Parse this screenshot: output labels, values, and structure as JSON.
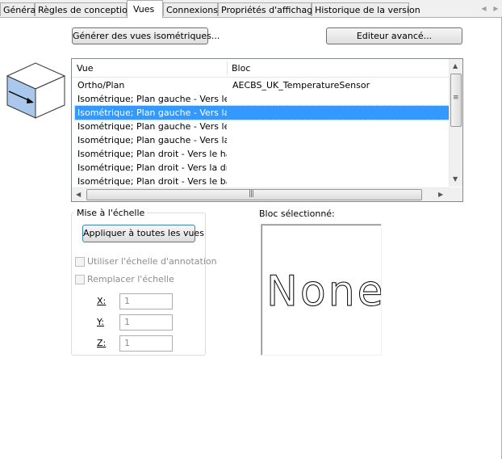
{
  "tabs": [
    {
      "label": "Général",
      "active": false
    },
    {
      "label": "Règles de conception",
      "active": false
    },
    {
      "label": "Vues",
      "active": true
    },
    {
      "label": "Connexions",
      "active": false
    },
    {
      "label": "Propriétés d'affichage",
      "active": false
    },
    {
      "label": "Historique de la version",
      "active": false
    }
  ],
  "buttons": {
    "generate_iso": "Générer des vues isométriques...",
    "advanced_editor": "Editeur avancé...",
    "apply_all": "Appliquer à toutes les vues"
  },
  "views_list": {
    "columns": [
      "Vue",
      "Bloc"
    ],
    "selected_index": 2,
    "rows": [
      {
        "vue": "Ortho/Plan",
        "bloc": "AECBS_UK_TemperatureSensor"
      },
      {
        "vue": "Isométrique; Plan gauche - Vers le ...",
        "bloc": ""
      },
      {
        "vue": "Isométrique; Plan gauche - Vers la ...",
        "bloc": ""
      },
      {
        "vue": "Isométrique; Plan gauche - Vers le bas",
        "bloc": ""
      },
      {
        "vue": "Isométrique; Plan gauche - Vers la ...",
        "bloc": ""
      },
      {
        "vue": "Isométrique; Plan droit - Vers le haut",
        "bloc": ""
      },
      {
        "vue": "Isométrique; Plan droit - Vers la droite",
        "bloc": ""
      },
      {
        "vue": "Isométrique; Plan droit - Vers le bas",
        "bloc": ""
      }
    ]
  },
  "scale": {
    "group_title": "Mise à l'échelle",
    "use_annotation_scale": {
      "label": "Utiliser l'échelle d'annotation",
      "checked": false
    },
    "override_scale": {
      "label": "Remplacer l'échelle",
      "checked": false
    },
    "x": {
      "label": "X:",
      "value": "1"
    },
    "y": {
      "label": "Y:",
      "value": "1"
    },
    "z": {
      "label": "Z:",
      "value": "1"
    }
  },
  "selected_block": {
    "label": "Bloc sélectionné:",
    "preview_text": "None"
  },
  "colors": {
    "selection": "#3399ff",
    "cube_front": "#a9c8ec",
    "cube_top": "#ffffff"
  },
  "icons": [
    "iso-cube-icon",
    "chevron-left-icon",
    "chevron-right-icon",
    "scroll-up-icon",
    "scroll-down-icon",
    "scroll-left-icon",
    "scroll-right-icon"
  ]
}
